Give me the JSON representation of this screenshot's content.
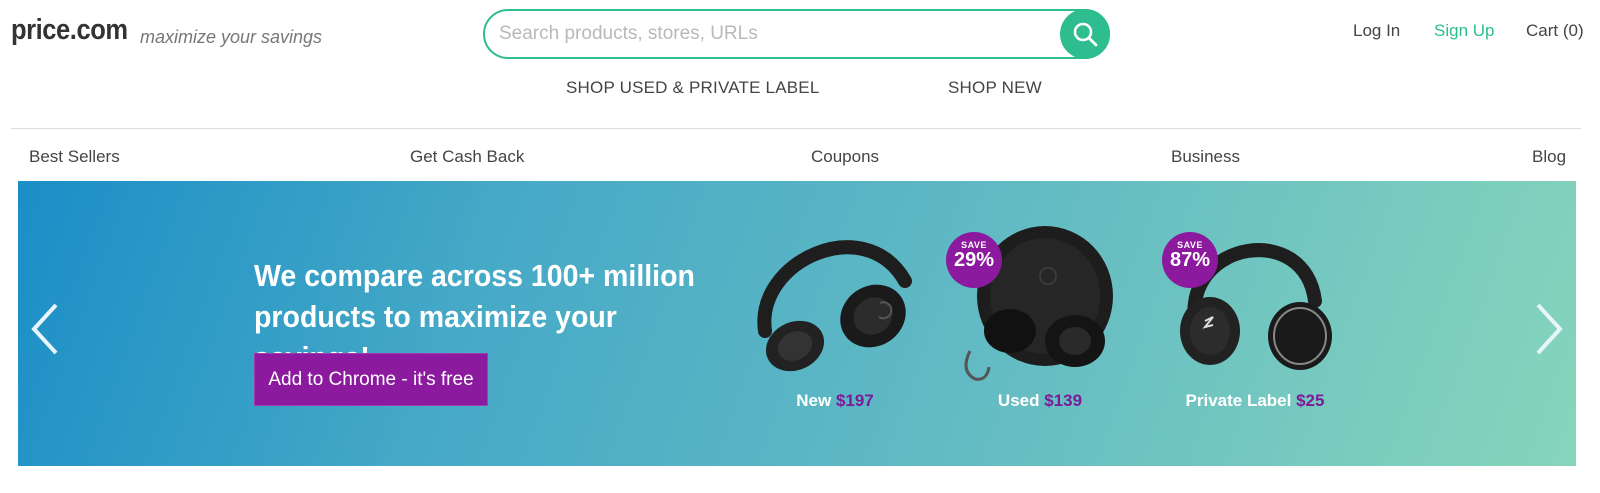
{
  "header": {
    "logo": "price.com",
    "tagline": "maximize your savings",
    "search_placeholder": "Search products, stores, URLs",
    "search_value": "",
    "login": "Log In",
    "signup": "Sign Up",
    "cart": "Cart (0)"
  },
  "subnav": {
    "shop_used": "SHOP USED & PRIVATE LABEL",
    "shop_new": "SHOP NEW"
  },
  "categories": [
    "Best Sellers",
    "Get Cash Back",
    "Coupons",
    "Business",
    "Blog"
  ],
  "banner": {
    "headline_line1": "We compare across 100+ million",
    "headline_line2": "products to maximize your savings!",
    "cta": "Add to Chrome - it's free",
    "products": [
      {
        "label": "New",
        "price": "$197"
      },
      {
        "label": "Used",
        "price": "$139",
        "save_word": "SAVE",
        "save_pct": "29%"
      },
      {
        "label": "Private Label",
        "price": "$25",
        "save_word": "SAVE",
        "save_pct": "87%"
      }
    ]
  },
  "colors": {
    "accent_green": "#2dbd8f",
    "accent_purple": "#8b1a9e",
    "banner_start": "#1b8ec7",
    "banner_end": "#86d5bb"
  }
}
